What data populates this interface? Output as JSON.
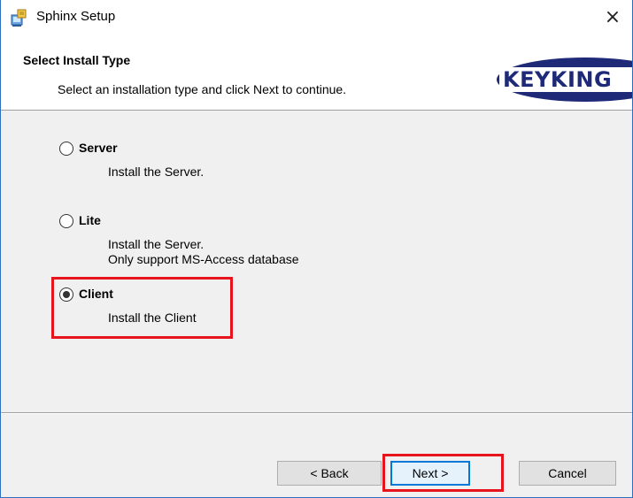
{
  "window": {
    "title": "Sphinx Setup",
    "close_glyph": "×",
    "app_icon": "setup-icon"
  },
  "header": {
    "title": "Select Install Type",
    "description": "Select an installation type and click Next to continue.",
    "logo_text": "KEYKING"
  },
  "options": [
    {
      "label": "Server",
      "description": [
        "Install the Server."
      ],
      "selected": false
    },
    {
      "label": "Lite",
      "description": [
        "Install the Server.",
        "Only support MS-Access database"
      ],
      "selected": false
    },
    {
      "label": "Client",
      "description": [
        "Install the Client"
      ],
      "selected": true
    }
  ],
  "buttons": {
    "back": "< Back",
    "next": "Next >",
    "cancel": "Cancel"
  },
  "colors": {
    "highlight": "#e8141d",
    "accent": "#0078d7",
    "logo": "#1e2a78"
  }
}
